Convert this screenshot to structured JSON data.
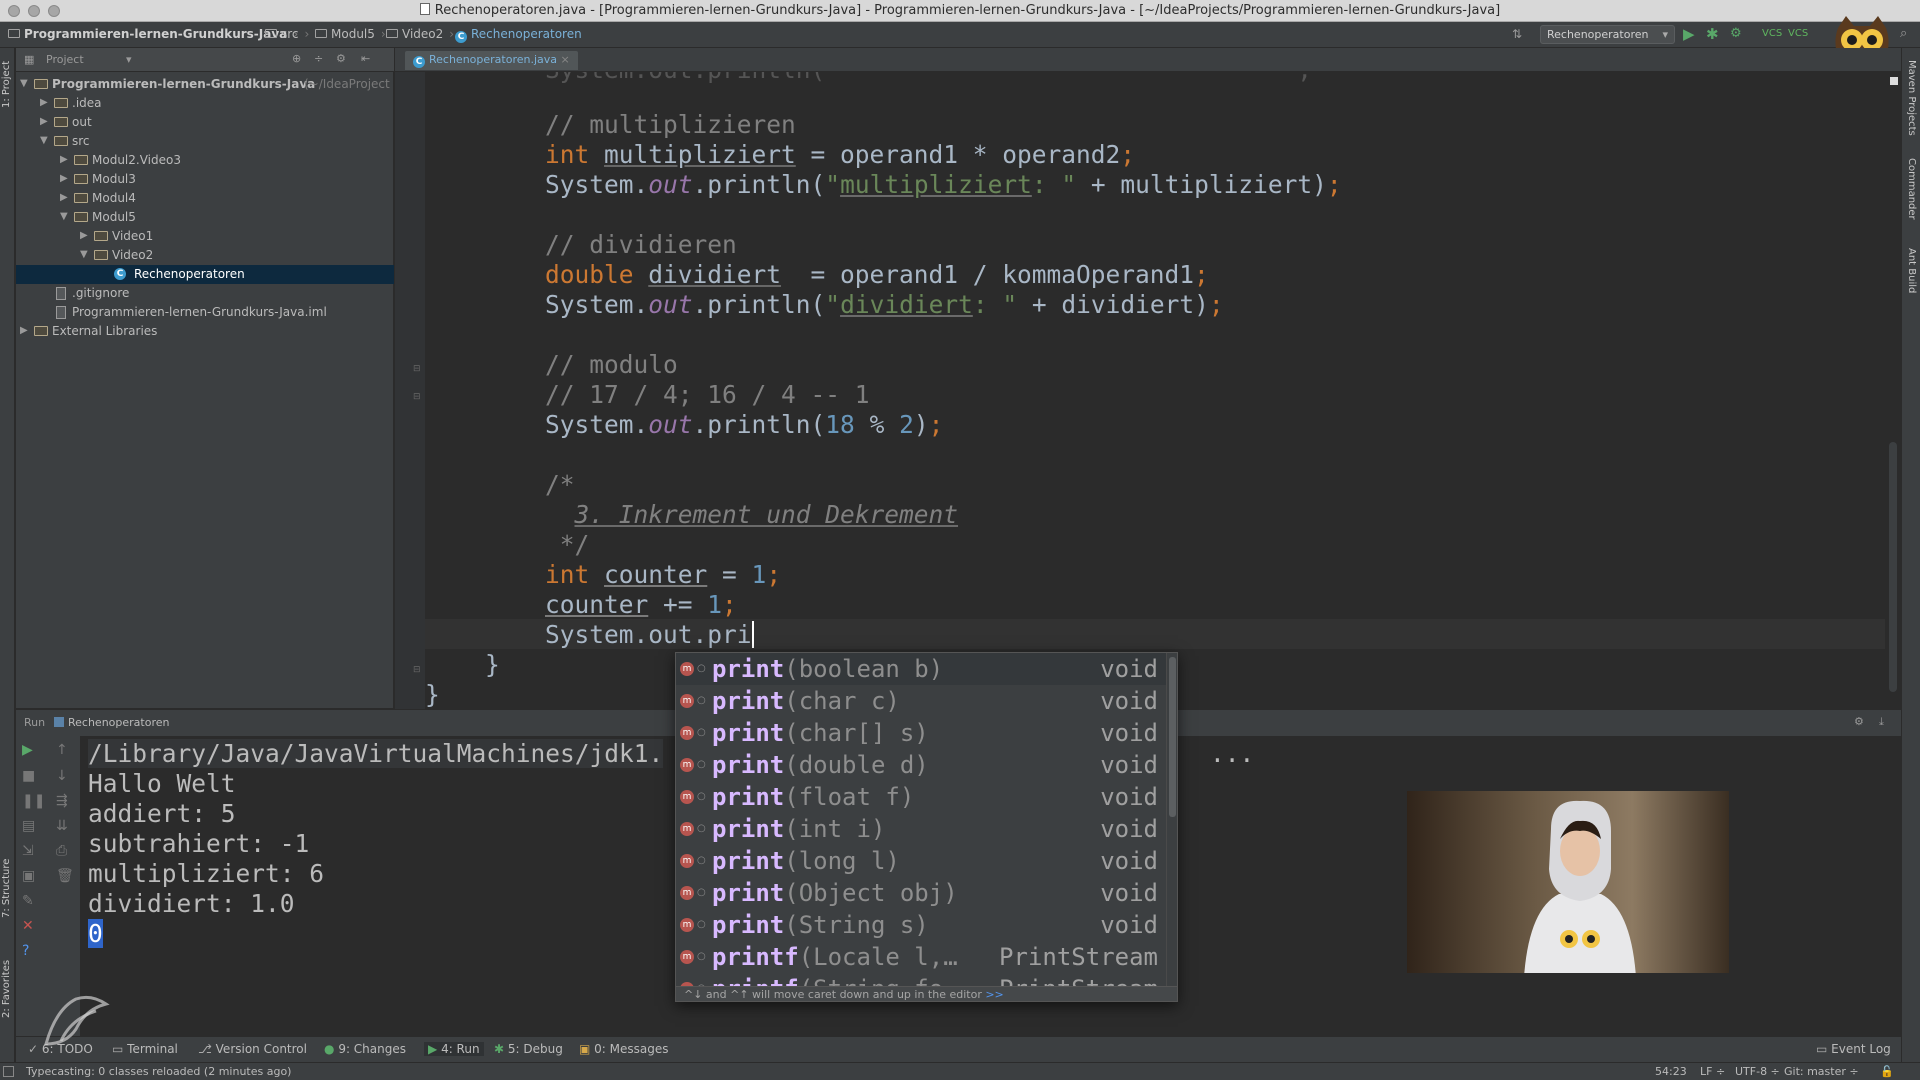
{
  "window": {
    "title": "Rechenoperatoren.java - [Programmieren-lernen-Grundkurs-Java] - Programmieren-lernen-Grundkurs-Java - [~/IdeaProjects/Programmieren-lernen-Grundkurs-Java]"
  },
  "navbar": {
    "crumbs": [
      "Programmieren-lernen-Grundkurs-Java",
      "src",
      "Modul5",
      "Video2",
      "Rechenoperatoren"
    ],
    "run_config": "Rechenoperatoren"
  },
  "side_tools": {
    "left": [
      "1: Project",
      "7: Structure",
      "2: Favorites"
    ],
    "right": [
      "Maven Projects",
      "Commander",
      "Ant Build"
    ]
  },
  "project_panel": {
    "header": "Project",
    "tree": [
      {
        "label": "Programmieren-lernen-Grundkurs-Java",
        "suffix": " (~/IdeaProject",
        "level": 0,
        "expanded": true,
        "kind": "module"
      },
      {
        "label": ".idea",
        "level": 1,
        "expanded": false,
        "kind": "folder"
      },
      {
        "label": "out",
        "level": 1,
        "expanded": false,
        "kind": "folder"
      },
      {
        "label": "src",
        "level": 1,
        "expanded": true,
        "kind": "folder"
      },
      {
        "label": "Modul2.Video3",
        "level": 2,
        "expanded": false,
        "kind": "folder"
      },
      {
        "label": "Modul3",
        "level": 2,
        "expanded": false,
        "kind": "folder"
      },
      {
        "label": "Modul4",
        "level": 2,
        "expanded": false,
        "kind": "folder"
      },
      {
        "label": "Modul5",
        "level": 2,
        "expanded": true,
        "kind": "folder"
      },
      {
        "label": "Video1",
        "level": 3,
        "expanded": false,
        "kind": "folder"
      },
      {
        "label": "Video2",
        "level": 3,
        "expanded": true,
        "kind": "folder"
      },
      {
        "label": "Rechenoperatoren",
        "level": 4,
        "kind": "class",
        "selected": true
      },
      {
        "label": ".gitignore",
        "level": 1,
        "kind": "file"
      },
      {
        "label": "Programmieren-lernen-Grundkurs-Java.iml",
        "level": 1,
        "kind": "file"
      },
      {
        "label": "External Libraries",
        "level": 0,
        "expanded": false,
        "kind": "library"
      }
    ]
  },
  "editor": {
    "tab": "Rechenoperatoren.java",
    "lines": [
      {
        "text": "// multiplizieren"
      },
      {
        "text": "int multipliziert = operand1 * operand2;"
      },
      {
        "text": "System.out.println(\"multipliziert: \" + multipliziert);"
      },
      {
        "text": ""
      },
      {
        "text": "// dividieren"
      },
      {
        "text": "double dividiert  = operand1 / kommaOperand1;"
      },
      {
        "text": "System.out.println(\"dividiert: \" + dividiert);"
      },
      {
        "text": ""
      },
      {
        "text": "// modulo"
      },
      {
        "text": "// 17 / 4; 16 / 4 -- 1"
      },
      {
        "text": "System.out.println(18 % 2);"
      },
      {
        "text": ""
      },
      {
        "text": "/*"
      },
      {
        "text": "  3. Inkrement und Dekrement"
      },
      {
        "text": " */"
      },
      {
        "text": "int counter = 1;"
      },
      {
        "text": "counter += 1;"
      },
      {
        "text": "System.out.pri"
      },
      {
        "text": "}"
      },
      {
        "text": "}"
      }
    ]
  },
  "autocomplete": {
    "typed": "pri",
    "items": [
      {
        "name": "print",
        "params": "(boolean b)",
        "ret": "void"
      },
      {
        "name": "print",
        "params": "(char c)",
        "ret": "void"
      },
      {
        "name": "print",
        "params": "(char[] s)",
        "ret": "void"
      },
      {
        "name": "print",
        "params": "(double d)",
        "ret": "void"
      },
      {
        "name": "print",
        "params": "(float f)",
        "ret": "void"
      },
      {
        "name": "print",
        "params": "(int i)",
        "ret": "void"
      },
      {
        "name": "print",
        "params": "(long l)",
        "ret": "void"
      },
      {
        "name": "print",
        "params": "(Object obj)",
        "ret": "void"
      },
      {
        "name": "print",
        "params": "(String s)",
        "ret": "void"
      },
      {
        "name": "printf",
        "params": "(Locale l,…",
        "ret": "PrintStream"
      },
      {
        "name": "printf",
        "params": "(String fo…",
        "ret": "PrintStream"
      }
    ],
    "footer": "^↓ and ^↑ will move caret down and up in the editor",
    "footer_link": ">>"
  },
  "run_panel": {
    "label": "Run",
    "config": "Rechenoperatoren",
    "output": [
      "/Library/Java/JavaVirtualMachines/jdk1.",
      "Hallo Welt",
      "addiert: 5",
      "subtrahiert: -1",
      "multipliziert: 6",
      "dividiert: 1.0",
      "0"
    ],
    "ellipsis": "..."
  },
  "bottom_tools": [
    "6: TODO",
    "Terminal",
    "Version Control",
    "9: Changes",
    "4: Run",
    "5: Debug",
    "0: Messages",
    "Event Log"
  ],
  "status": {
    "message": "Typecasting: 0 classes reloaded (2 minutes ago)",
    "position": "54:23",
    "line_sep": "LF ÷",
    "encoding": "UTF-8 ÷",
    "vcs": "Git: master ÷"
  },
  "colors": {
    "editor_bg": "#2b2b2b",
    "panel_bg": "#3c3f41",
    "keyword": "#cc7832",
    "string": "#6a8759",
    "number": "#6897bb",
    "field": "#9876aa",
    "selection": "#0d293e"
  }
}
